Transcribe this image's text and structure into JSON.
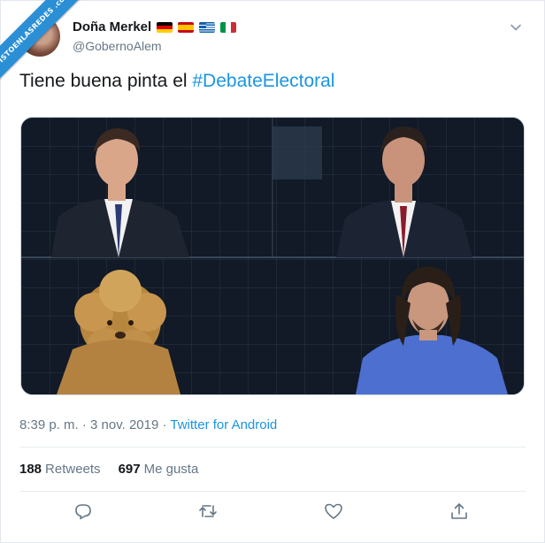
{
  "watermark": "VISTOENLASREDES .com",
  "user": {
    "display_name": "Doña Merkel",
    "handle": "@GobernoAlem",
    "flags": [
      "germany",
      "spain",
      "greece",
      "italy"
    ]
  },
  "tweet": {
    "text": "Tiene buena pinta el ",
    "hashtag": "#DebateElectoral"
  },
  "meta": {
    "timestamp": "8:39 p. m. · 3 nov. 2019 · ",
    "source": "Twitter for Android"
  },
  "stats": {
    "retweets_count": "188",
    "retweets_label": "Retweets",
    "likes_count": "697",
    "likes_label": "Me gusta"
  },
  "actions": [
    "reply-icon",
    "retweet-icon",
    "like-icon",
    "share-icon"
  ],
  "colors": {
    "link": "#1b95e0",
    "muted": "#657786",
    "text": "#14171a"
  }
}
